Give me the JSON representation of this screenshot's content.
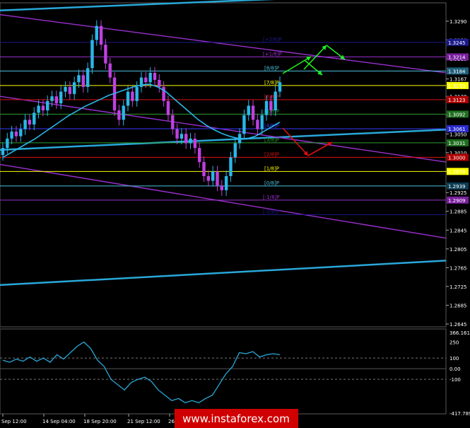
{
  "chart_data": {
    "type": "line",
    "price_axis": {
      "ticks": [
        "1.3290",
        "1.3250",
        "1.3210",
        "1.3167",
        "1.3130",
        "1.3090",
        "1.3050",
        "1.3010",
        "1.2970",
        "1.2925",
        "1.2885",
        "1.2845",
        "1.2805",
        "1.2765",
        "1.2725",
        "1.2685",
        "1.2645"
      ],
      "ylim": [
        1.263,
        1.3335
      ]
    },
    "price_tags": [
      {
        "text": "1.3184",
        "bg": "#1f5f7a",
        "fg": "#ffffff",
        "price": 1.3184
      },
      {
        "text": "1.3153",
        "bg": "#ffff00",
        "fg": "#000000",
        "price": 1.3153
      },
      {
        "text": "1.3123",
        "bg": "#b00000",
        "fg": "#ffffff",
        "price": 1.3123
      },
      {
        "text": "1.3092",
        "bg": "#1f6e1f",
        "fg": "#ffffff",
        "price": 1.3092
      },
      {
        "text": "1.3061",
        "bg": "#2b2bd0",
        "fg": "#ffffff",
        "price": 1.3061
      },
      {
        "text": "1.3031",
        "bg": "#1f6e1f",
        "fg": "#ffffff",
        "price": 1.3031
      },
      {
        "text": "1.3000",
        "bg": "#b00000",
        "fg": "#ffffff",
        "price": 1.3
      },
      {
        "text": "1.2970",
        "bg": "#ffff00",
        "fg": "#000000",
        "price": 1.297
      },
      {
        "text": "1.2939",
        "bg": "#0b3e55",
        "fg": "#ffffff",
        "price": 1.2939
      },
      {
        "text": "1.2909",
        "bg": "#7a1f9e",
        "fg": "#ffffff",
        "price": 1.2909
      },
      {
        "text": "1.3214",
        "bg": "#7a1f9e",
        "fg": "#ffffff",
        "price": 1.3214
      },
      {
        "text": "1.3245",
        "bg": "#1a1a8a",
        "fg": "#ffffff",
        "price": 1.3245
      }
    ],
    "murrey_levels": [
      {
        "label": "[+2/8]P",
        "price": 1.3245,
        "color": "#1a1a8a"
      },
      {
        "label": "[+1/8]P",
        "price": 1.3214,
        "color": "#9b30d0"
      },
      {
        "label": "[8/8]P",
        "price": 1.3184,
        "color": "#4cc3e0"
      },
      {
        "label": "[7/8]P",
        "price": 1.3153,
        "color": "#ffff00"
      },
      {
        "label": "[6/8]P",
        "price": 1.3123,
        "color": "#e01010"
      },
      {
        "label": "[5/8]P",
        "price": 1.3092,
        "color": "#2ea02e"
      },
      {
        "label": "[4/8]P",
        "price": 1.3061,
        "color": "#3a3aff"
      },
      {
        "label": "[3/8]P",
        "price": 1.3031,
        "color": "#2ea02e"
      },
      {
        "label": "[2/8]P",
        "price": 1.3,
        "color": "#e01010"
      },
      {
        "label": "[1/8]P",
        "price": 1.297,
        "color": "#ffff00"
      },
      {
        "label": "[0/8]P",
        "price": 1.2939,
        "color": "#4cc3e0"
      },
      {
        "label": "[-1/8]P",
        "price": 1.2909,
        "color": "#9b30d0"
      },
      {
        "label": "[-2/8]P",
        "price": 1.2878,
        "color": "#1a1a8a"
      }
    ],
    "x_labels": [
      "Sep 12:00",
      "14 Sep 04:00",
      "18 Sep 20:00",
      "21 Sep 12:00",
      "26 Sep 04:00"
    ],
    "candles_close": [
      1.302,
      1.304,
      1.3055,
      1.3045,
      1.306,
      1.308,
      1.307,
      1.3095,
      1.311,
      1.31,
      1.312,
      1.313,
      1.3115,
      1.314,
      1.315,
      1.3135,
      1.316,
      1.3175,
      1.315,
      1.319,
      1.325,
      1.328,
      1.324,
      1.32,
      1.317,
      1.31,
      1.308,
      1.311,
      1.314,
      1.312,
      1.315,
      1.317,
      1.316,
      1.318,
      1.3165,
      1.315,
      1.312,
      1.309,
      1.306,
      1.304,
      1.305,
      1.303,
      1.304,
      1.302,
      1.299,
      1.296,
      1.295,
      1.297,
      1.294,
      1.293,
      1.296,
      1.3,
      1.303,
      1.305,
      1.309,
      1.311,
      1.308,
      1.306,
      1.309,
      1.312,
      1.31,
      1.314,
      1.316
    ],
    "moving_average": [
      1.3,
      1.301,
      1.302,
      1.303,
      1.304,
      1.3052,
      1.3064,
      1.3076,
      1.3088,
      1.3098,
      1.3108,
      1.3116,
      1.3124,
      1.3132,
      1.3138,
      1.3144,
      1.315,
      1.3154,
      1.3156,
      1.315,
      1.314,
      1.3125,
      1.311,
      1.3095,
      1.308,
      1.3068,
      1.3058,
      1.305,
      1.3044,
      1.304,
      1.304,
      1.3045,
      1.3055,
      1.3065,
      1.3075
    ],
    "channels": [
      {
        "color": "#29a8d8",
        "price_start": 1.3313,
        "price_end": 1.3341
      },
      {
        "color": "#29a8d8",
        "price_start": 1.3016,
        "price_end": 1.3059
      },
      {
        "color": "#29a8d8",
        "price_start": 1.2728,
        "price_end": 1.278
      },
      {
        "color": "#9b30d0",
        "price_start": 1.3304,
        "price_end": 1.318
      },
      {
        "color": "#9b30d0",
        "price_start": 1.313,
        "price_end": 1.299
      },
      {
        "color": "#9b30d0",
        "price_start": 1.2985,
        "price_end": 1.2828
      }
    ],
    "cci": {
      "ticks": [
        "366.161",
        "250",
        "100",
        "0.00",
        "-100",
        "-417.789"
      ],
      "ylim": [
        -417.789,
        366.161
      ],
      "values": [
        80,
        60,
        90,
        70,
        110,
        70,
        100,
        60,
        130,
        90,
        150,
        210,
        250,
        190,
        80,
        20,
        -100,
        -150,
        -200,
        -130,
        -100,
        -80,
        -120,
        -200,
        -250,
        -300,
        -280,
        -320,
        -300,
        -320,
        -280,
        -250,
        -150,
        -50,
        20,
        150,
        140,
        160,
        110,
        130,
        140,
        130
      ],
      "color": "#29a8d8"
    },
    "watermark": "www.instaforex.com"
  }
}
